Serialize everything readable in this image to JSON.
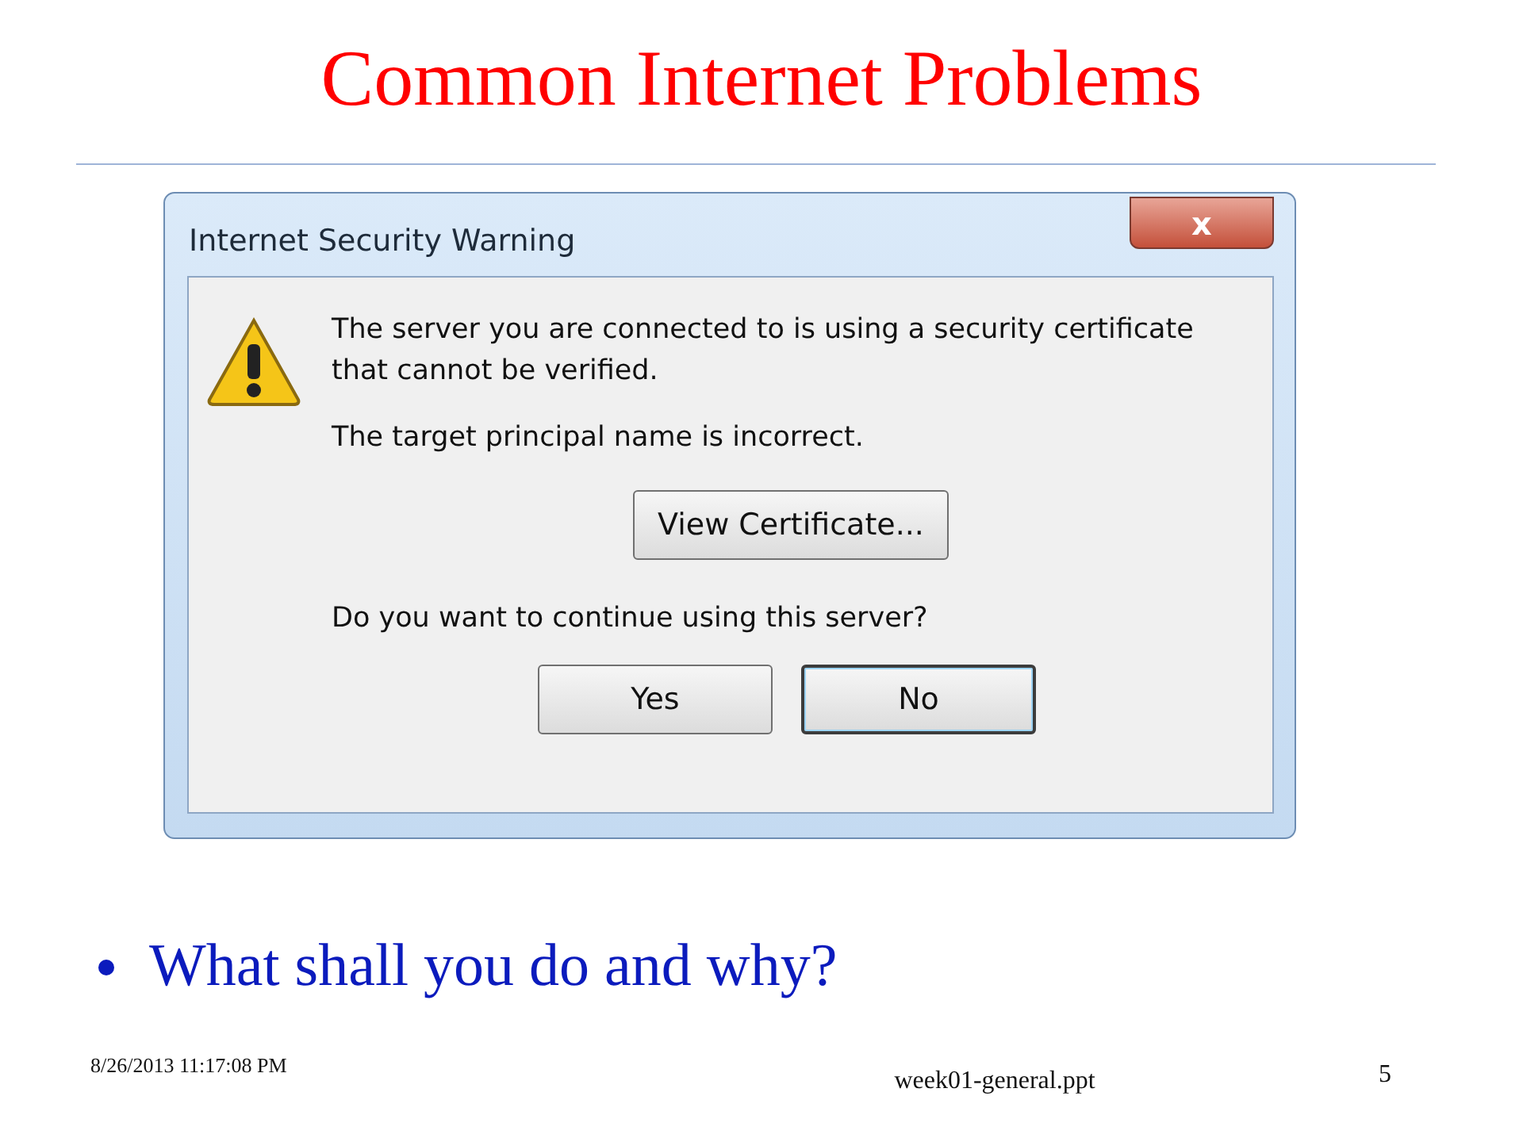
{
  "slide": {
    "title": "Common Internet Problems",
    "dialog": {
      "title": "Internet Security Warning",
      "close_label": "x",
      "message": "The server you are connected to is using a security certificate that cannot be verified.",
      "detail": "The target principal name is incorrect.",
      "view_button": "View Certificate...",
      "question": "Do you want to continue using this server?",
      "buttons": [
        {
          "label": "Yes",
          "selected": false
        },
        {
          "label": "No",
          "selected": true
        }
      ]
    },
    "bullets": [
      "What shall you do and why?"
    ],
    "footer": {
      "date": "8/26/2013 11:17:08 PM",
      "file": "week01-general.ppt",
      "page": "5"
    }
  }
}
